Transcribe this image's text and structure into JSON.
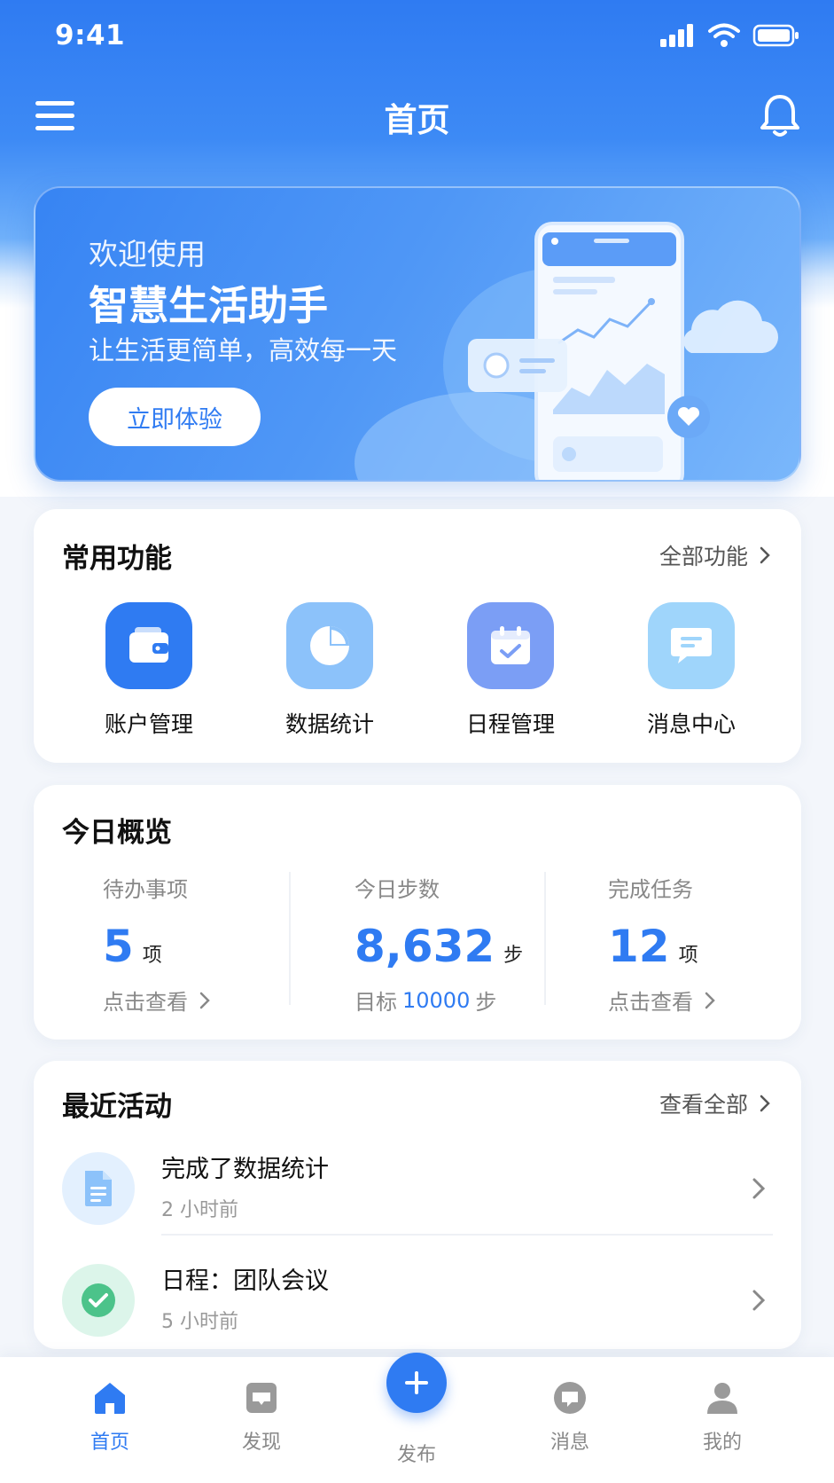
{
  "status_bar": {
    "time": "9:41"
  },
  "header": {
    "title": "首页"
  },
  "banner": {
    "subtitle": "欢迎使用",
    "title": "智慧生活助手",
    "description": "让生活更简单，高效每一天",
    "button_label": "立即体验"
  },
  "functions": {
    "title": "常用功能",
    "more_label": "全部功能",
    "items": [
      {
        "label": "账户管理",
        "icon": "wallet-icon",
        "color": "#2f7bf2"
      },
      {
        "label": "数据统计",
        "icon": "pie-chart-icon",
        "color": "#8cc2fa"
      },
      {
        "label": "日程管理",
        "icon": "calendar-icon",
        "color": "#7b9ef5"
      },
      {
        "label": "消息中心",
        "icon": "message-icon",
        "color": "#9fd5fb"
      }
    ]
  },
  "overview": {
    "title": "今日概览",
    "todo": {
      "label": "待办事项",
      "value": "5",
      "unit": "项",
      "link": "点击查看"
    },
    "steps": {
      "label": "今日步数",
      "value": "8,632",
      "unit": "步",
      "goal_prefix": "目标",
      "goal_value": "10000",
      "goal_unit": "步"
    },
    "tasks": {
      "label": "完成任务",
      "value": "12",
      "unit": "项",
      "link": "点击查看"
    }
  },
  "activity": {
    "title": "最近活动",
    "more_label": "查看全部",
    "items": [
      {
        "title": "完成了数据统计",
        "time": "2 小时前",
        "icon": "document-icon"
      },
      {
        "title": "日程：团队会议",
        "time": "5 小时前",
        "icon": "check-circle-icon"
      }
    ]
  },
  "tabbar": {
    "tabs": [
      {
        "label": "首页",
        "icon": "home-icon",
        "active": true
      },
      {
        "label": "发现",
        "icon": "discover-icon",
        "active": false
      },
      {
        "label": "发布",
        "icon": "plus-icon",
        "active": false
      },
      {
        "label": "消息",
        "icon": "chat-icon",
        "active": false
      },
      {
        "label": "我的",
        "icon": "user-icon",
        "active": false
      }
    ]
  },
  "colors": {
    "primary": "#2f7bf2",
    "success": "#4cc38a",
    "text_muted": "#888888"
  }
}
